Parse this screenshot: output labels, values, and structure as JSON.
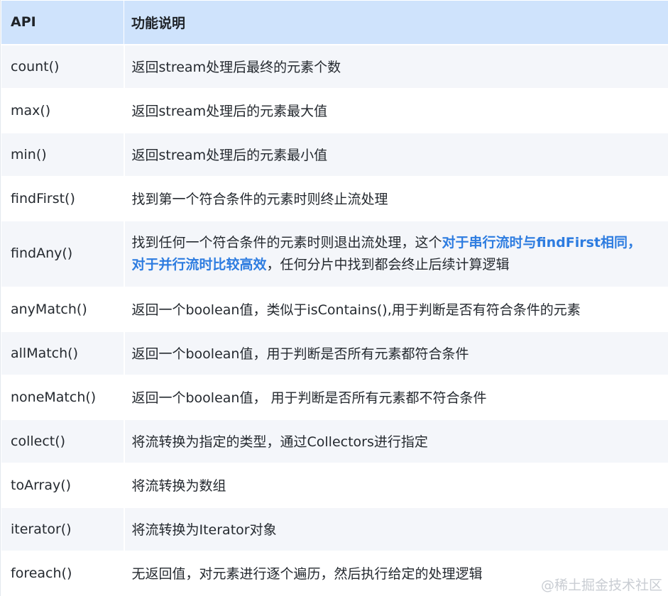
{
  "header": {
    "api": "API",
    "desc": "功能说明"
  },
  "rows": [
    {
      "api": "count()",
      "desc": "返回stream处理后最终的元素个数"
    },
    {
      "api": "max()",
      "desc": "返回stream处理后的元素最大值"
    },
    {
      "api": "min()",
      "desc": "返回stream处理后的元素最小值"
    },
    {
      "api": "findFirst()",
      "desc": "找到第一个符合条件的元素时则终止流处理"
    },
    {
      "api": "findAny()",
      "desc_line1_a": "找到任何一个符合条件的元素时则退出流处理，这个",
      "desc_line1_b": "对于串行流时与findFirst相同，",
      "desc_line2_a": "对于并行流时比较高效",
      "desc_line2_b": "，任何分片中找到都会终止后续计算逻辑"
    },
    {
      "api": "anyMatch()",
      "desc": "返回一个boolean值，类似于isContains(),用于判断是否有符合条件的元素"
    },
    {
      "api": "allMatch()",
      "desc": "返回一个boolean值，用于判断是否所有元素都符合条件"
    },
    {
      "api": "noneMatch()",
      "desc": "返回一个boolean值， 用于判断是否所有元素都不符合条件"
    },
    {
      "api": "collect()",
      "desc": "将流转换为指定的类型，通过Collectors进行指定"
    },
    {
      "api": "toArray()",
      "desc": "将流转换为数组"
    },
    {
      "api": "iterator()",
      "desc": "将流转换为Iterator对象"
    },
    {
      "api": "foreach()",
      "desc": "无返回值，对元素进行逐个遍历，然后执行给定的处理逻辑"
    }
  ],
  "watermark": "@稀土掘金技术社区",
  "colors": {
    "header_bg": "#cfe3fc",
    "row_bg": "#f4f6fa",
    "highlight": "#2d7ce0"
  }
}
